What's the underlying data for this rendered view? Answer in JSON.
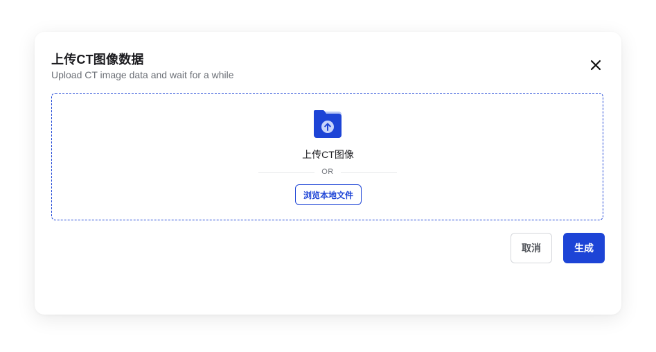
{
  "dialog": {
    "title": "上传CT图像数据",
    "subtitle": "Upload CT image data and wait for a while",
    "close_icon": "close-icon"
  },
  "dropzone": {
    "icon": "folder-upload-icon",
    "label": "上传CT图像",
    "divider_text": "OR",
    "browse_label": "浏览本地文件"
  },
  "actions": {
    "cancel_label": "取消",
    "generate_label": "生成"
  },
  "colors": {
    "primary": "#1d44d6",
    "folder_back": "#b9c8f5",
    "text": "#1b1b1f",
    "muted": "#6b6f76"
  }
}
